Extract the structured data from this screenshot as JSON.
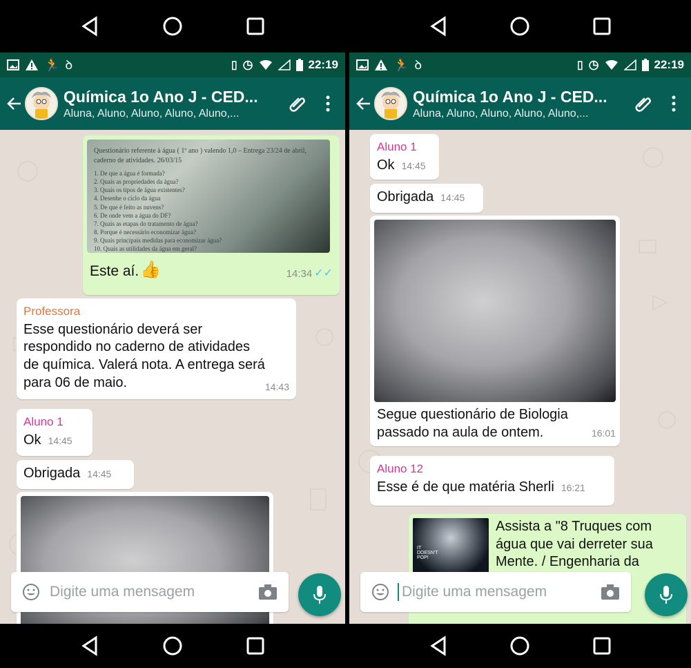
{
  "status": {
    "time": "22:19"
  },
  "chat": {
    "title": "Química 1o Ano J - CED...",
    "subtitle": "Aluna, Aluno, Aluno, Aluno, Aluno,..."
  },
  "input": {
    "placeholder": "Digite uma mensagem"
  },
  "left_messages": {
    "photo_text": [
      "Questionário referente à água ( 1º ano )  valendo 1,0 – Entrega 23/24  de abril, caderno de atividades. 26/03/15",
      "1. De que a água é formada?",
      "2. Quais as propriedades da  água?",
      "3. Quais os tipos de água existentes?",
      "4. Desenhe o ciclo da água",
      "5. De que é feito as nuvens?",
      "6. De onde vem a água do DF?",
      "7. Quais as etapas do tratamento de água?",
      "8. Porque é necessário economizar água?",
      "9. Quais principais medidas para economizar água?",
      "10. Quais as utilidades da água em geral?"
    ],
    "caption": "Este aí.",
    "caption_time": "14:34",
    "prof_sender": "Professora",
    "prof_text": "Esse questionário deverá ser respondido no caderno de atividades de química. Valerá nota. A entrega será para 06 de maio.",
    "prof_time": "14:43",
    "aluno1_sender": "Aluno 1",
    "ok_text": "Ok",
    "ok_time": "14:45",
    "obrigada_text": "Obrigada",
    "obrigada_time": "14:45"
  },
  "right_messages": {
    "aluno1_sender": "Aluno 1",
    "ok_text": "Ok",
    "ok_time": "14:45",
    "obrigada_text": "Obrigada",
    "obrigada_time": "14:45",
    "bio_caption": "Segue questionário de Biologia passado na aula de ontem.",
    "bio_time": "16:01",
    "aluno12_sender": "Aluno 12",
    "aluno12_text": "Esse é de que matéria Sherli",
    "aluno12_time": "16:21",
    "video_text": "Assista a \"8 Truques com água que vai derreter sua Mente. / Engenharia da",
    "video_thumb_label": "IT DOESN'T POP!"
  }
}
